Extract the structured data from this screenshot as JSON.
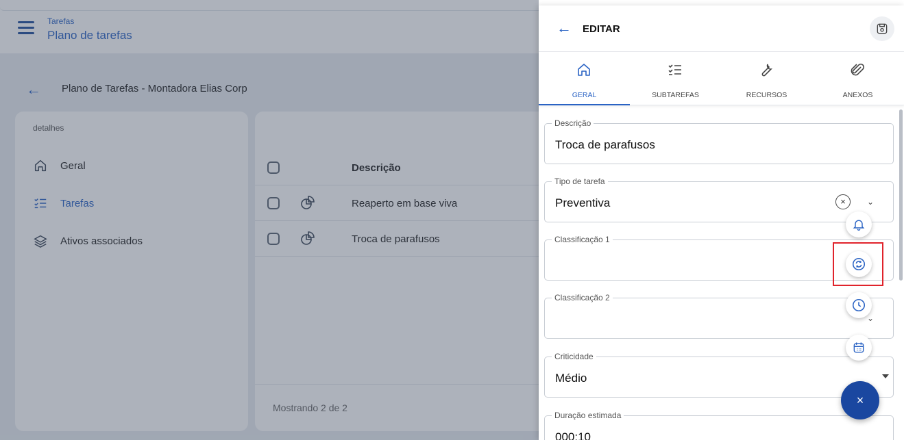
{
  "header": {
    "section": "Tarefas",
    "title": "Plano de tarefas"
  },
  "page": {
    "title": "Plano de Tarefas - Montadora Elias Corp"
  },
  "details": {
    "caption": "detalhes",
    "items": [
      {
        "label": "Geral",
        "icon": "home-icon",
        "active": false
      },
      {
        "label": "Tarefas",
        "icon": "checklist-icon",
        "active": true
      },
      {
        "label": "Ativos associados",
        "icon": "layers-icon",
        "active": false
      }
    ]
  },
  "table": {
    "column_description": "Descrição",
    "rows": [
      {
        "description": "Reaperto em base viva",
        "icon": "task-icon"
      },
      {
        "description": "Troca de parafusos",
        "icon": "task-icon"
      }
    ],
    "footer": "Mostrando 2 de 2"
  },
  "drawer": {
    "title": "EDITAR",
    "tabs": [
      {
        "label": "GERAL",
        "icon": "home-icon",
        "active": true
      },
      {
        "label": "SUBTAREFAS",
        "icon": "checklist-icon",
        "active": false
      },
      {
        "label": "RECURSOS",
        "icon": "wrench-icon",
        "active": false
      },
      {
        "label": "ANEXOS",
        "icon": "paperclip-icon",
        "active": false
      }
    ],
    "fields": {
      "descricao": {
        "label": "Descrição",
        "value": "Troca de parafusos"
      },
      "tipo": {
        "label": "Tipo de tarefa",
        "value": "Preventiva"
      },
      "classificacao1": {
        "label": "Classificação 1",
        "value": ""
      },
      "classificacao2": {
        "label": "Classificação 2",
        "value": ""
      },
      "criticidade": {
        "label": "Criticidade",
        "value": "Médio"
      },
      "duracao": {
        "label": "Duração estimada",
        "value": "000:10"
      }
    }
  },
  "fab": {
    "close_label": "×",
    "actions": [
      "bell-icon",
      "sync-icon",
      "clock-icon",
      "calendar-icon"
    ]
  },
  "colors": {
    "accent": "#2a63c4",
    "fab": "#1a47a0",
    "highlight": "#e0232b"
  }
}
